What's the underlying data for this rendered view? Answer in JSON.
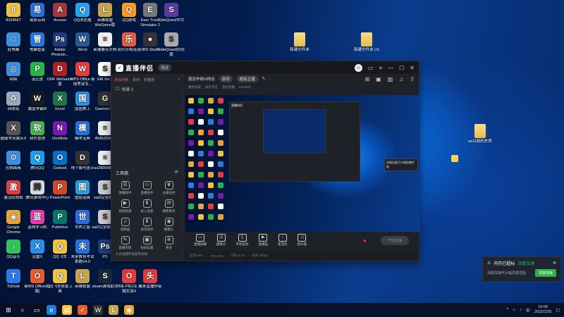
{
  "desktop": {
    "icons": [
      {
        "label": "8334667",
        "color": "#f0c040",
        "glyph": "8"
      },
      {
        "label": "易影云网",
        "color": "#2a6fd8",
        "glyph": "易"
      },
      {
        "label": "Access",
        "color": "#a4373a",
        "glyph": "A"
      },
      {
        "label": "QQ浏览器",
        "color": "#27a3f1",
        "glyph": "Q"
      },
      {
        "label": "英雄联盟WeGame版",
        "color": "#c7a34b",
        "glyph": "L"
      },
      {
        "label": "QQ游戏",
        "color": "#ff9a1f",
        "glyph": "Q"
      },
      {
        "label": "Euro Truck Simulator 2",
        "color": "#777",
        "glyph": "E"
      },
      {
        "label": "SideQuest中文",
        "color": "#5b3a9e",
        "glyph": "S"
      },
      {
        "label": "此电脑",
        "color": "#3d8fe0",
        "glyph": "□"
      },
      {
        "label": "电脑管家",
        "color": "#1f7be0",
        "glyph": "管"
      },
      {
        "label": "Adobe Photosh...",
        "color": "#1e3d7a",
        "glyph": "Ps"
      },
      {
        "label": "Word",
        "color": "#2b5797",
        "glyph": "W"
      },
      {
        "label": "新建要点文档",
        "color": "#eee",
        "glyph": "≡"
      },
      {
        "label": "双乐乐啦连连",
        "color": "#e85b3b",
        "glyph": "乐"
      },
      {
        "label": "OBS Studio",
        "color": "#333",
        "glyph": "●"
      },
      {
        "label": "SideQuest(0)化版",
        "color": "#aaa",
        "glyph": "S"
      },
      {
        "label": "网络",
        "color": "#3d8fe0",
        "glyph": "◎"
      },
      {
        "label": "泡芝皮",
        "color": "#2ab34a",
        "glyph": "P"
      },
      {
        "label": "DNF WeGame版",
        "color": "#b02020",
        "glyph": "D"
      },
      {
        "label": "WPS Office 新用考试专...",
        "color": "#e83b3b",
        "glyph": "W"
      },
      {
        "label": "SAI Ver.2",
        "color": "#fff",
        "glyph": "S"
      },
      {
        "label": "回收站",
        "color": "#9ab",
        "glyph": "♻"
      },
      {
        "label": "魔兽争霸III",
        "color": "#1a1a1a",
        "glyph": "W"
      },
      {
        "label": "Excel",
        "color": "#217346",
        "glyph": "X"
      },
      {
        "label": "国图美工",
        "color": "#2a8fd8",
        "glyph": "国"
      },
      {
        "label": "GaomonT...",
        "color": "#333",
        "glyph": "G"
      },
      {
        "label": "超级学员跟从X",
        "color": "#555",
        "glyph": "X"
      },
      {
        "label": "软件管理",
        "color": "#48b34a",
        "glyph": "软"
      },
      {
        "label": "OneNote",
        "color": "#7719aa",
        "glyph": "N"
      },
      {
        "label": "模考宝典",
        "color": "#2a6fd8",
        "glyph": "模"
      },
      {
        "label": "45452556...",
        "color": "#eee",
        "glyph": "≡"
      },
      {
        "label": "控制面板",
        "color": "#3d8fe0",
        "glyph": "⚙"
      },
      {
        "label": "腾讯QQ",
        "color": "#1aa0ea",
        "glyph": "Q"
      },
      {
        "label": "Outlook",
        "color": "#0072c6",
        "glyph": "O"
      },
      {
        "label": "地下城与勇士",
        "color": "#333",
        "glyph": "D"
      },
      {
        "label": "uu2909488...",
        "color": "#eee",
        "glyph": "≡"
      },
      {
        "label": "激活码领取",
        "color": "#e83b3b",
        "glyph": "激"
      },
      {
        "label": "腾讯游戏中心",
        "color": "#ddd",
        "glyph": "腾"
      },
      {
        "label": "PowerPoint",
        "color": "#d24726",
        "glyph": "P"
      },
      {
        "label": "图层道具",
        "color": "#2aa0d8",
        "glyph": "图"
      },
      {
        "label": "sai2完全版本",
        "color": "#ccc",
        "glyph": "S"
      },
      {
        "label": "uu2909488...",
        "color": "#eee",
        "glyph": "≡"
      },
      {
        "label": "Google Chrome",
        "color": "#e8a33b",
        "glyph": "◉"
      },
      {
        "label": "蓝翔学习机",
        "color": "#e83bb0",
        "glyph": "蓝"
      },
      {
        "label": "Publisher",
        "color": "#077568",
        "glyph": "P"
      },
      {
        "label": "世界之窗",
        "color": "#2a6fd8",
        "glyph": "世"
      },
      {
        "label": "sai2完全版本版",
        "color": "#ccc",
        "glyph": "S"
      },
      {
        "label": "uu2909488...",
        "color": "#eee",
        "glyph": "≡"
      },
      {
        "label": "QQ音乐",
        "color": "#32c25c",
        "glyph": "♪"
      },
      {
        "label": "迅雷X",
        "color": "#2a8fe8",
        "glyph": "X"
      },
      {
        "label": "QQ飞车",
        "color": "#f2c33b",
        "glyph": "Q"
      },
      {
        "label": "未来教育考试系统V4.0",
        "color": "#2a6fd8",
        "glyph": "未"
      },
      {
        "label": "PS",
        "color": "#1e3d7a",
        "glyph": "Ps"
      },
      {
        "label": "ToDesk",
        "color": "#2a7be8",
        "glyph": "T"
      },
      {
        "label": "新MS Office(旧版)",
        "color": "#e85b2b",
        "glyph": "O"
      },
      {
        "label": "QQ飞车修复工具",
        "color": "#f2c33b",
        "glyph": "Q"
      },
      {
        "label": "英雄联盟",
        "color": "#c7a34b",
        "glyph": "L"
      },
      {
        "label": "steam游戏助手",
        "color": "#1b2838",
        "glyph": "S"
      },
      {
        "label": "ONE PIECE 海贼无双4",
        "color": "#e83b3b",
        "glyph": "O"
      },
      {
        "label": "头条直播伴侣",
        "color": "#e83b3b",
        "glyph": "头"
      }
    ],
    "folders": [
      {
        "label": "新建文件夹"
      },
      {
        "label": "新建文件夹 (2)"
      },
      {
        "label": "qa以前的东西"
      }
    ]
  },
  "app": {
    "title": "直播伴侣",
    "version": "测试",
    "tabs": [
      "添加场景",
      "素材",
      "花猫场"
    ],
    "scene": "场景 1",
    "tools_header": "工具箱",
    "tools": [
      "弹幕助手",
      "直播助手",
      "主播任务",
      "视频连麦",
      "录入连麦",
      "播客助手",
      "话筒画",
      "录音助手",
      "摄像头",
      "直播内容",
      "投屏设置",
      "更多"
    ],
    "hint": "头条直播伴侣使用说明",
    "room": {
      "title": "魔兽争霸III精选",
      "tag1": "游戏",
      "tag2": "超级主播"
    },
    "sub": [
      "魔兽争霸",
      "娱乐专区",
      "电竞直播",
      "8334657"
    ],
    "bottom": [
      "直播屏幕",
      "摄像头",
      "手机投屏",
      "直播画",
      "麦克风",
      "扬声器"
    ],
    "live": "开始直播",
    "stat": [
      "延迟 0ms",
      "CPU 23%",
      "内存 8.1G",
      "码率 0kbps"
    ]
  },
  "toast": {
    "title": "内存已超标",
    "link": "深度加速",
    "body": "深度加速可大幅改善性能",
    "btn": "深度加速"
  },
  "taskbar": {
    "time": "19:00",
    "date": "2022/12/5"
  }
}
